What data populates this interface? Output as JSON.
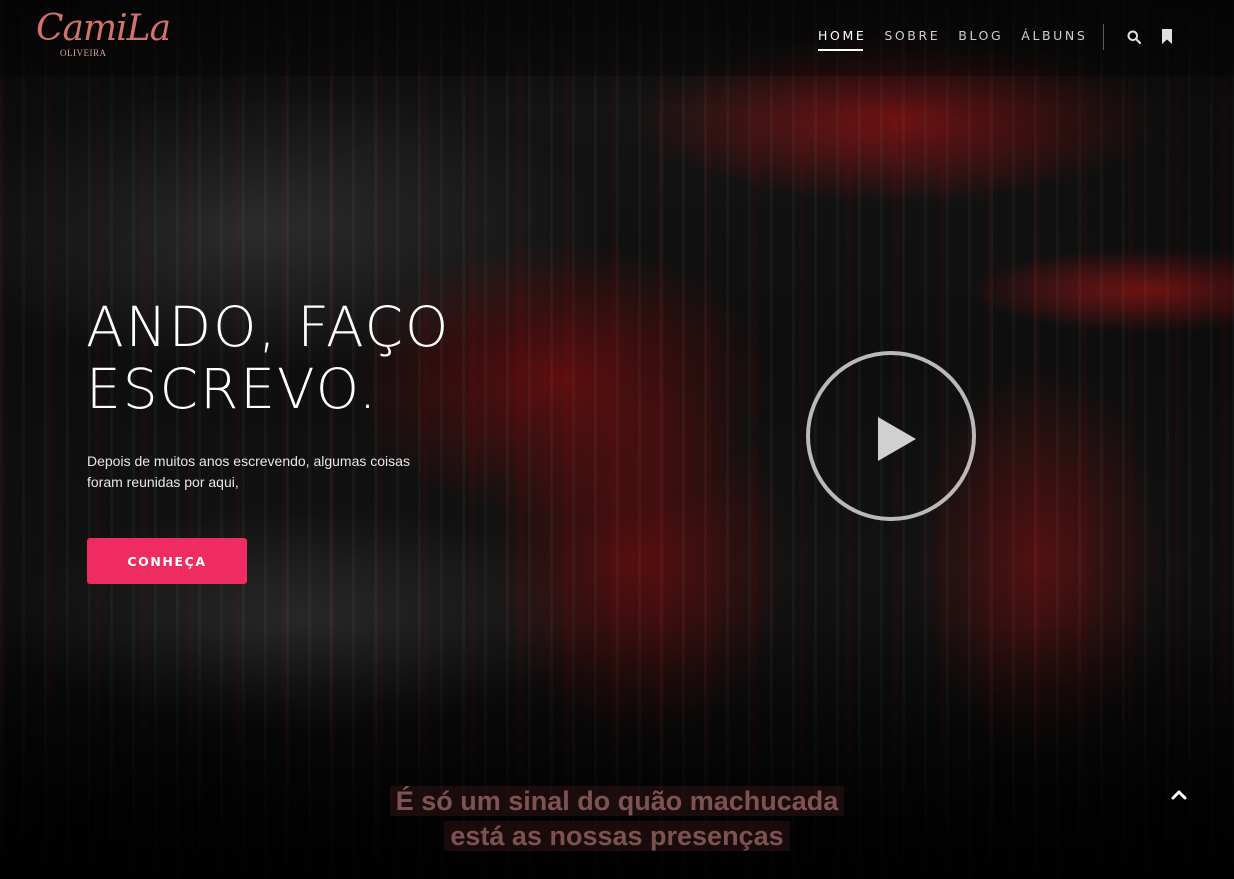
{
  "brand": {
    "logo_script": "CamiLa",
    "logo_sub": "OLIVEIRA"
  },
  "nav": {
    "items": [
      {
        "label": "HOME",
        "active": true
      },
      {
        "label": "SOBRE",
        "active": false
      },
      {
        "label": "BLOG",
        "active": false
      },
      {
        "label": "ÁLBUNS",
        "active": false
      }
    ],
    "icons": [
      "search-icon",
      "bookmark-icon"
    ]
  },
  "hero": {
    "title_line1": "ANDO, FAÇO",
    "title_line2": "ESCREVO.",
    "lead": "Depois de muitos anos escrevendo, algumas coisas foram reunidas por aqui,",
    "cta_label": "CONHEÇA",
    "play_icon": "play-icon"
  },
  "caption": {
    "line1": "É só um sinal do quão machucada",
    "line2": "está as nossas presenças"
  },
  "colors": {
    "accent": "#ee2c61",
    "logo": "#d4706e",
    "text": "#ffffff"
  },
  "scroll_top_icon": "chevron-up-icon"
}
